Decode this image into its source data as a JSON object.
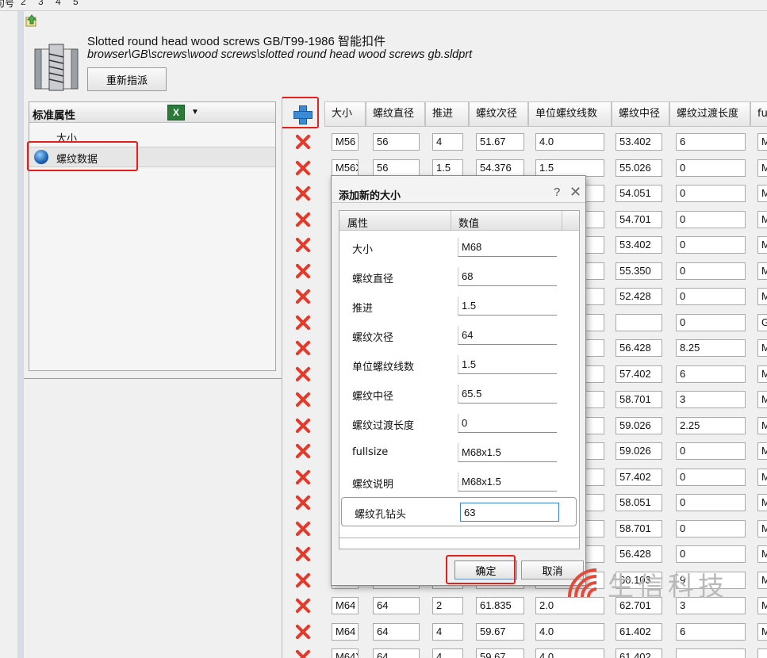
{
  "top_tabs": [
    "句号",
    "2",
    "3",
    "4",
    "5"
  ],
  "header": {
    "title": "Slotted round head wood screws GB/T99-1986 智能扣件",
    "path": "browser\\GB\\screws\\wood screws\\slotted round head wood screws gb.sldprt",
    "reassign_label": "重新指派"
  },
  "tree": {
    "header_label": "标准属性",
    "excel_icon_label": "X",
    "items": [
      {
        "label": "大小"
      },
      {
        "label": "螺纹数据"
      }
    ]
  },
  "grid": {
    "columns": [
      "大小",
      "螺纹直径",
      "推进",
      "螺纹次径",
      "单位螺纹线数",
      "螺纹中径",
      "螺纹过渡长度",
      "ful"
    ],
    "rows": [
      [
        "M56",
        "56",
        "4",
        "51.67",
        "4.0",
        "53.402",
        "6",
        "M"
      ],
      [
        "M56X",
        "56",
        "1.5",
        "54.376",
        "1.5",
        "55.026",
        "0",
        "M"
      ],
      [
        "",
        "",
        "",
        "",
        "",
        "54.051",
        "0",
        "M"
      ],
      [
        "",
        "",
        "",
        "",
        "",
        "54.701",
        "0",
        "M"
      ],
      [
        "",
        "",
        "",
        "",
        "",
        "53.402",
        "0",
        "M"
      ],
      [
        "",
        "",
        "",
        "",
        "",
        "55.350",
        "0",
        "M"
      ],
      [
        "",
        "",
        "",
        "",
        "",
        "52.428",
        "0",
        "M"
      ],
      [
        "",
        "",
        "",
        "",
        "",
        "",
        "0",
        "G"
      ],
      [
        "",
        "",
        "",
        "",
        "",
        "56.428",
        "8.25",
        "M"
      ],
      [
        "",
        "",
        "",
        "",
        "",
        "57.402",
        "6",
        "M"
      ],
      [
        "",
        "",
        "",
        "",
        "",
        "58.701",
        "3",
        "M"
      ],
      [
        "",
        "",
        "",
        "",
        "",
        "59.026",
        "2.25",
        "M"
      ],
      [
        "",
        "",
        "",
        "",
        "",
        "59.026",
        "0",
        "M"
      ],
      [
        "",
        "",
        "",
        "",
        "",
        "57.402",
        "0",
        "M"
      ],
      [
        "",
        "",
        "",
        "",
        "",
        "58.051",
        "0",
        "M"
      ],
      [
        "",
        "",
        "",
        "",
        "",
        "58.701",
        "0",
        "M"
      ],
      [
        "",
        "",
        "",
        "",
        "",
        "56.428",
        "0",
        "M"
      ],
      [
        "",
        "",
        "",
        "",
        "",
        "60.103",
        "9",
        "M"
      ],
      [
        "M64",
        "64",
        "2",
        "61.835",
        "2.0",
        "62.701",
        "3",
        "M"
      ],
      [
        "M64",
        "64",
        "4",
        "59.67",
        "4.0",
        "61.402",
        "6",
        "M"
      ],
      [
        "M64X",
        "64",
        "4",
        "59.67",
        "4.0",
        "61.402",
        "",
        ""
      ]
    ]
  },
  "dialog": {
    "title": "添加新的大小",
    "help_glyph": "?",
    "close_glyph": "✕",
    "col_property": "属性",
    "col_value": "数值",
    "props": [
      {
        "label": "大小",
        "value": "M68"
      },
      {
        "label": "螺纹直径",
        "value": "68"
      },
      {
        "label": "推进",
        "value": "1.5"
      },
      {
        "label": "螺纹次径",
        "value": "64"
      },
      {
        "label": "单位螺纹线数",
        "value": "1.5"
      },
      {
        "label": "螺纹中径",
        "value": "65.5"
      },
      {
        "label": "螺纹过渡长度",
        "value": "0"
      },
      {
        "label": "fullsize",
        "value": "M68x1.5"
      },
      {
        "label": "螺纹说明",
        "value": "M68x1.5"
      },
      {
        "label": "螺纹孔钻头",
        "value": "63"
      }
    ],
    "ok_label": "确定",
    "cancel_label": "取消"
  },
  "watermark": {
    "text": "生信科技"
  },
  "colors": {
    "highlight": "#e3201b",
    "delete": "#e33a2a",
    "add": "#3b8ad6"
  }
}
